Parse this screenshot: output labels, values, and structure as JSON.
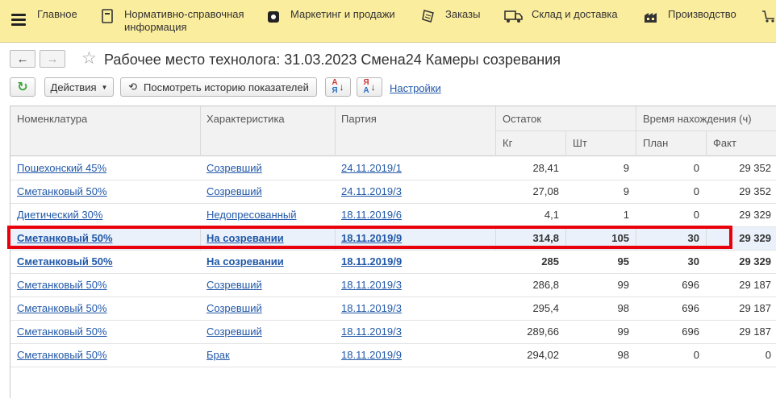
{
  "nav": {
    "items": [
      {
        "label": "Главное",
        "icon": "menu-icon"
      },
      {
        "label": "Нормативно-справочная\nинформация",
        "icon": "document-icon"
      },
      {
        "label": "Маркетинг и продажи",
        "icon": "marketing-icon"
      },
      {
        "label": "Заказы",
        "icon": "orders-icon"
      },
      {
        "label": "Склад и доставка",
        "icon": "truck-icon"
      },
      {
        "label": "Производство",
        "icon": "factory-icon"
      }
    ]
  },
  "window": {
    "title": "Рабочее место технолога: 31.03.2023 Смена24 Камеры созревания"
  },
  "toolbar": {
    "actions_label": "Действия",
    "history_label": "Посмотреть историю показателей",
    "settings_label": "Настройки"
  },
  "table": {
    "headers": {
      "nomenclature": "Номенклатура",
      "characteristic": "Характеристика",
      "batch": "Партия",
      "remainder": "Остаток",
      "kg": "Кг",
      "pcs": "Шт",
      "time": "Время нахождения (ч)",
      "plan": "План",
      "fact": "Факт"
    },
    "rows": [
      {
        "nomenclature": "Пошехонский 45%",
        "characteristic": "Созревший",
        "batch": "24.11.2019/1",
        "kg": "28,41",
        "pcs": "9",
        "plan": "0",
        "fact": "29 352"
      },
      {
        "nomenclature": "Сметанковый 50%",
        "characteristic": "Созревший",
        "batch": "24.11.2019/3",
        "kg": "27,08",
        "pcs": "9",
        "plan": "0",
        "fact": "29 352"
      },
      {
        "nomenclature": "Диетический 30%",
        "characteristic": "Недопресованный",
        "batch": "18.11.2019/6",
        "kg": "4,1",
        "pcs": "1",
        "plan": "0",
        "fact": "29 329"
      },
      {
        "nomenclature": "Сметанковый 50%",
        "characteristic": "На созревании",
        "batch": "18.11.2019/9",
        "kg": "314,8",
        "pcs": "105",
        "plan": "30",
        "fact": "29 329"
      },
      {
        "nomenclature": "Сметанковый 50%",
        "characteristic": "На созревании",
        "batch": "18.11.2019/9",
        "kg": "285",
        "pcs": "95",
        "plan": "30",
        "fact": "29 329"
      },
      {
        "nomenclature": "Сметанковый 50%",
        "characteristic": "Созревший",
        "batch": "18.11.2019/3",
        "kg": "286,8",
        "pcs": "99",
        "plan": "696",
        "fact": "29 187"
      },
      {
        "nomenclature": "Сметанковый 50%",
        "characteristic": "Созревший",
        "batch": "18.11.2019/3",
        "kg": "295,4",
        "pcs": "98",
        "plan": "696",
        "fact": "29 187"
      },
      {
        "nomenclature": "Сметанковый 50%",
        "characteristic": "Созревший",
        "batch": "18.11.2019/3",
        "kg": "289,66",
        "pcs": "99",
        "plan": "696",
        "fact": "29 187"
      },
      {
        "nomenclature": "Сметанковый 50%",
        "characteristic": "Брак",
        "batch": "18.11.2019/9",
        "kg": "294,02",
        "pcs": "98",
        "plan": "0",
        "fact": "0"
      }
    ]
  },
  "colors": {
    "nav_bg": "#fbed9e",
    "link": "#2158a8",
    "highlight": "#e8000a"
  }
}
